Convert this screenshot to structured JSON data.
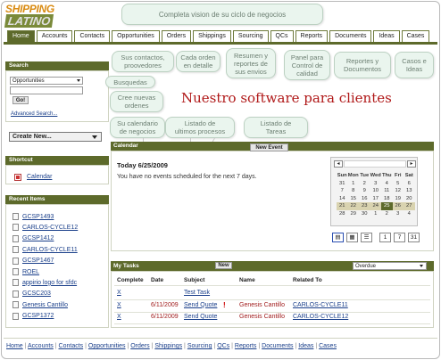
{
  "logo": {
    "line1": "SHIPPING",
    "line2": "LATINO"
  },
  "tabs": [
    "Home",
    "Accounts",
    "Contacts",
    "Opportunities",
    "Orders",
    "Shippings",
    "Sourcing",
    "QCs",
    "Reports",
    "Documents",
    "Ideas",
    "Cases"
  ],
  "active_tab": "Home",
  "callouts": {
    "top": "Completa vision de su ciclo de negocios",
    "contacts": "Sus contactos,\nproovedores",
    "orders": "Cada orden\nen detalle",
    "shippings": "Resumen y\nreportes de\nsus envios",
    "qcs": "Panel para\nControl de\ncalidad",
    "reports": "Reportes y\nDocumentos",
    "cases": "Casos e\nIdeas",
    "search": "Busquedas",
    "create": "Cree nuevas\nordenes",
    "calendar": "Su calendario\nde negocios",
    "processes": "Listado de\nultimos procesos",
    "tasks": "Listado de\nTareas"
  },
  "headline": "Nuestro software para clientes",
  "sidebar": {
    "search_title": "Search",
    "search_select": "Opportunities",
    "go_label": "Go!",
    "advanced": "Advanced Search...",
    "create_new": "Create New...",
    "shortcut_title": "Shortcut",
    "shortcut_link": "Calendar",
    "recent_title": "Recent Items",
    "recent_items": [
      "GCSP1493",
      "CARLOS-CYCLE12",
      "GCSP1412",
      "CARLOS-CYCLE11",
      "GCSP1467",
      "ROEL",
      "appirio logo for sfdc",
      "GCSC203",
      "Genesis Cantillo",
      "GCSP1372"
    ]
  },
  "calendar": {
    "title": "Calendar",
    "new_event": "New Event",
    "today": "Today 6/25/2009",
    "no_events": "You have no events scheduled for the next 7 days.",
    "day_headers": [
      "Sun",
      "Mon",
      "Tue",
      "Wed",
      "Thu",
      "Fri",
      "Sat"
    ],
    "weeks": [
      [
        "31",
        "1",
        "2",
        "3",
        "4",
        "5",
        "6"
      ],
      [
        "7",
        "8",
        "9",
        "10",
        "11",
        "12",
        "13"
      ],
      [
        "14",
        "15",
        "16",
        "17",
        "18",
        "19",
        "20"
      ],
      [
        "21",
        "22",
        "23",
        "24",
        "25",
        "26",
        "27"
      ],
      [
        "28",
        "29",
        "30",
        "1",
        "2",
        "3",
        "4"
      ]
    ],
    "highlight_week": 3,
    "today_day": "25",
    "view_buttons": [
      "▤",
      "▦",
      "☰",
      "1",
      "7",
      "31"
    ]
  },
  "tasks": {
    "title": "My Tasks",
    "new_label": "New",
    "filter": "Overdue",
    "columns": [
      "Complete",
      "Date",
      "Subject",
      "Name",
      "Related To"
    ],
    "rows": [
      {
        "complete": "X",
        "date": "",
        "subject": "Test Task",
        "flag": "",
        "name": "",
        "related": ""
      },
      {
        "complete": "X",
        "date": "6/11/2009",
        "subject": "Send Quote",
        "flag": "!",
        "name": "Genesis Cantillo",
        "related": "CARLOS-CYCLE11"
      },
      {
        "complete": "X",
        "date": "6/11/2009",
        "subject": "Send Quote",
        "flag": "",
        "name": "Genesis Cantillo",
        "related": "CARLOS-CYCLE12"
      }
    ]
  },
  "footer": [
    "Home",
    "Accounts",
    "Contacts",
    "Opportunities",
    "Orders",
    "Shippings",
    "Sourcing",
    "QCs",
    "Reports",
    "Documents",
    "Ideas",
    "Cases"
  ],
  "colors": {
    "olive": "#5d6a2b",
    "callout_bg": "#eaf5ee",
    "headline": "#b01818",
    "link": "#1a3f8a"
  }
}
